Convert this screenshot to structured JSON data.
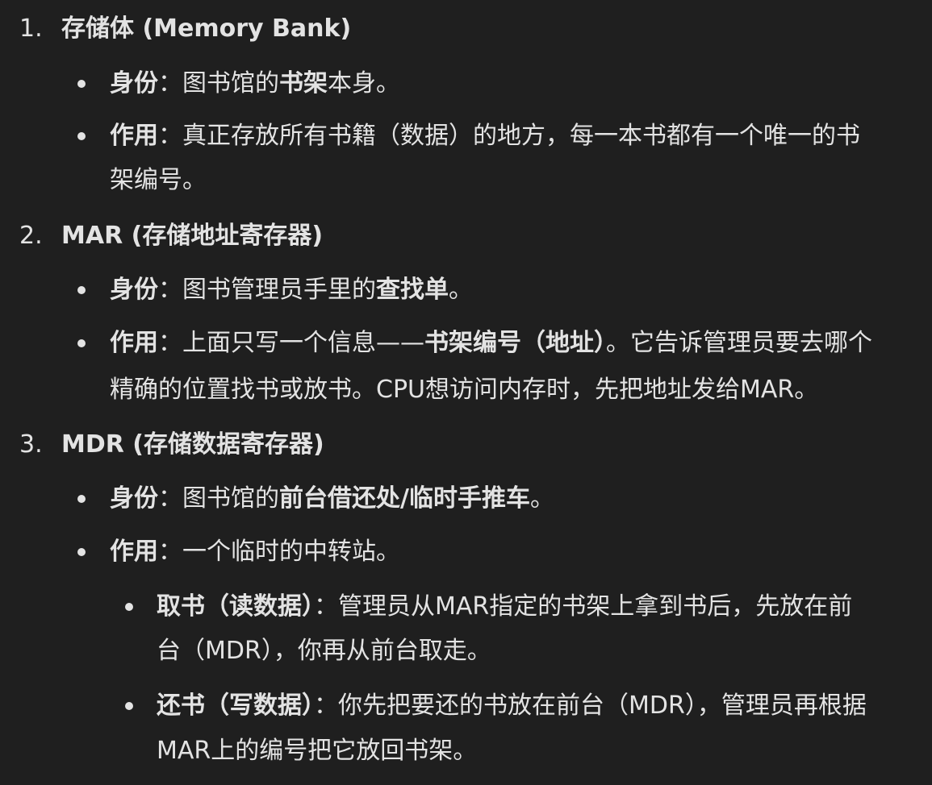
{
  "items": [
    {
      "number": "1.",
      "heading": "存储体 (Memory Bank)",
      "bullets": [
        {
          "label": "身份",
          "sep": "：",
          "text_a": "图书馆的",
          "bold_a": "书架",
          "text_b": "本身。"
        },
        {
          "label": "作用",
          "sep": "：",
          "line1": "真正存放所有书籍（数据）的地方，每一本书都有一个唯一的书",
          "line2": "架编号。"
        }
      ]
    },
    {
      "number": "2.",
      "heading": "MAR (存储地址寄存器)",
      "bullets": [
        {
          "label": "身份",
          "sep": "：",
          "text_a": "图书管理员手里的",
          "bold_a": "查找单",
          "text_b": "。"
        },
        {
          "label": "作用",
          "sep": "：",
          "text_a": "上面只写一个信息——",
          "bold_a": "书架编号（地址）",
          "text_b": "。它告诉管理员要去哪个",
          "line2": "精确的位置找书或放书。CPU想访问内存时，先把地址发给MAR。"
        }
      ]
    },
    {
      "number": "3.",
      "heading": "MDR (存储数据寄存器)",
      "bullets": [
        {
          "label": "身份",
          "sep": "：",
          "text_a": "图书馆的",
          "bold_a": "前台借还处/临时手推车",
          "text_b": "。"
        },
        {
          "label": "作用",
          "sep": "：",
          "text_a": "一个临时的中转站。"
        }
      ],
      "sub_bullets": [
        {
          "label": "取书（读数据）",
          "sep": "：",
          "line1": "管理员从MAR指定的书架上拿到书后，先放在前",
          "line2": "台（MDR），你再从前台取走。"
        },
        {
          "label": "还书（写数据）",
          "sep": "：",
          "line1": "你先把要还的书放在前台（MDR），管理员再根据",
          "line2": "MAR上的编号把它放回书架。"
        }
      ]
    }
  ]
}
